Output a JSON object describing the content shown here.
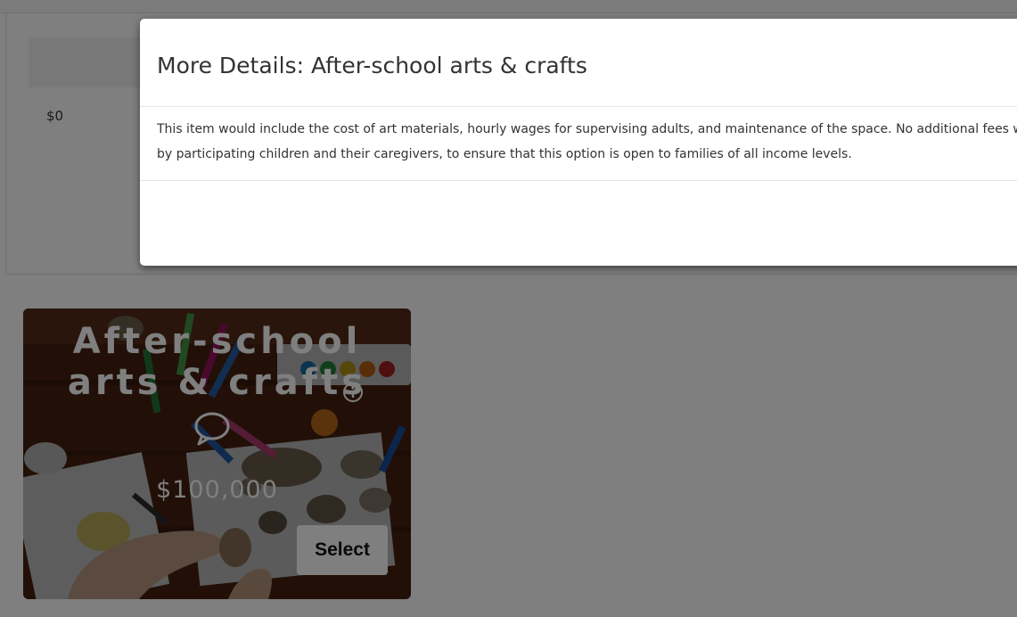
{
  "budget": {
    "amount": "$0"
  },
  "card": {
    "title": "After-school arts & crafts",
    "price": "$100,000",
    "select_label": "Select",
    "info_icon": "info-icon",
    "comment_icon": "comment-icon"
  },
  "modal": {
    "title": "More Details: After-school arts & crafts",
    "body_line1": "This item would include the cost of art materials, hourly wages for supervising adults, and maintenance of the space. No additional fees wou",
    "body_line2": "by participating children and their caregivers, to ensure that this option is open to families of all income levels."
  },
  "colors": {
    "overlay": "#000000",
    "modal_bg": "#ffffff",
    "text": "#333333"
  }
}
